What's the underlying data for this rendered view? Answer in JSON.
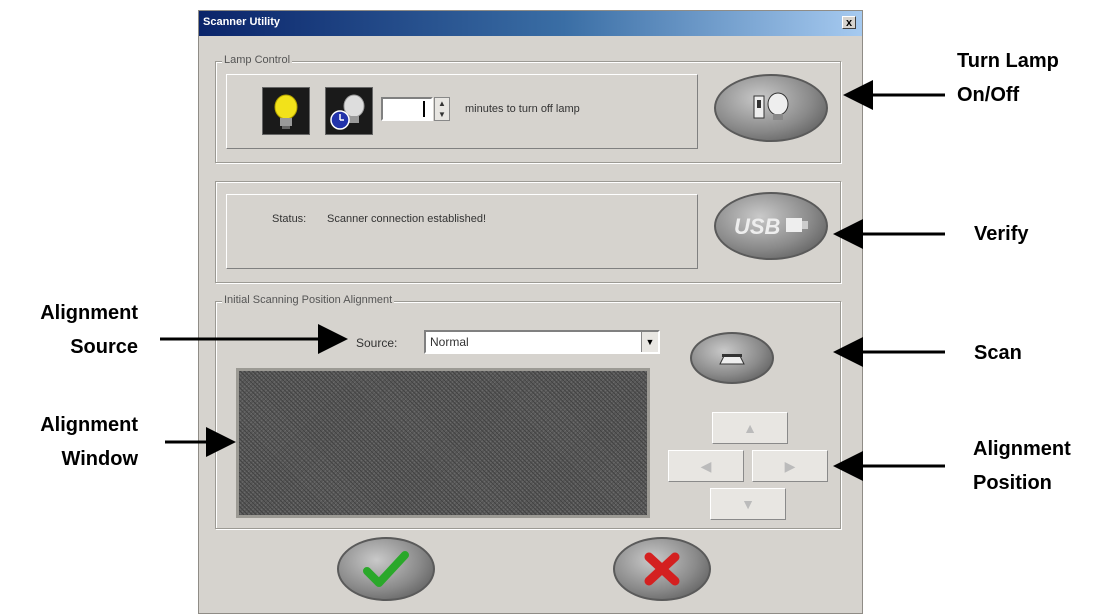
{
  "window": {
    "title": "Scanner Utility",
    "close_glyph": "x"
  },
  "lamp_control": {
    "legend": "Lamp Control",
    "lamp_icon": "lightbulb-icon",
    "timer_icon": "lamp-timer-icon",
    "minutes_value": "",
    "minutes_label": "minutes to turn off lamp",
    "toggle_icon": "lamp-switch-icon"
  },
  "status_panel": {
    "label": "Status:",
    "message": "Scanner connection established!",
    "verify_icon": "usb-icon",
    "usb_text": "USB"
  },
  "alignment": {
    "legend": "Initial Scanning Position Alignment",
    "source_label": "Source:",
    "source_value": "Normal",
    "scan_icon": "scanner-icon",
    "arrows": {
      "up": "up-arrow-icon",
      "left": "left-arrow-icon",
      "right": "right-arrow-icon",
      "down": "down-arrow-icon"
    }
  },
  "footer": {
    "ok_icon": "checkmark-icon",
    "cancel_icon": "x-icon"
  },
  "annotations": {
    "turn_lamp_line1": "Turn Lamp",
    "turn_lamp_line2": "On/Off",
    "verify": "Verify",
    "scan": "Scan",
    "alignment_position_line1": "Alignment",
    "alignment_position_line2": "Position",
    "alignment_source_line1": "Alignment",
    "alignment_source_line2": "Source",
    "alignment_window_line1": "Alignment",
    "alignment_window_line2": "Window"
  },
  "colors": {
    "title_bar": "#0a246a",
    "dialog_bg": "#d6d3ce",
    "check_green": "#2aa82a",
    "cancel_red": "#d42020",
    "lamp_yellow": "#f2e21a"
  }
}
